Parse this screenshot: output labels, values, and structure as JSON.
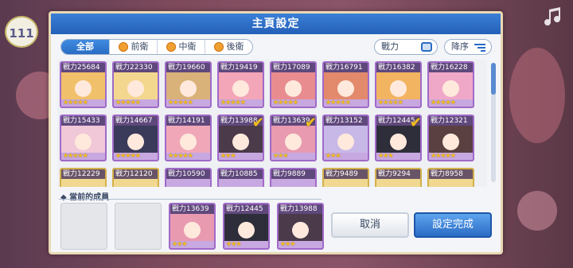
{
  "side": {
    "counter": "111"
  },
  "dialog": {
    "title": "主頁設定",
    "tabs": [
      {
        "label": "全部",
        "active": true,
        "icon": ""
      },
      {
        "label": "前衛",
        "active": false,
        "icon": "vanguard-icon"
      },
      {
        "label": "中衛",
        "active": false,
        "icon": "midguard-icon"
      },
      {
        "label": "後衛",
        "active": false,
        "icon": "rearguard-icon"
      }
    ],
    "sort": {
      "power_label": "戰力",
      "order_label": "降序"
    },
    "cards": [
      {
        "power": "戰力25684",
        "stars": "★★★★★",
        "border": "purple",
        "selected": false,
        "hue": "#f1c06a"
      },
      {
        "power": "戰力22330",
        "stars": "★★★★★",
        "border": "purple",
        "selected": false,
        "hue": "#f4d78e"
      },
      {
        "power": "戰力19660",
        "stars": "★★★★★",
        "border": "purple",
        "selected": false,
        "hue": "#d9b27a"
      },
      {
        "power": "戰力19419",
        "stars": "★★★★★",
        "border": "purple",
        "selected": false,
        "hue": "#f3a6b8"
      },
      {
        "power": "戰力17089",
        "stars": "★★★★★",
        "border": "purple",
        "selected": false,
        "hue": "#e88c90"
      },
      {
        "power": "戰力16791",
        "stars": "★★★★★",
        "border": "purple",
        "selected": false,
        "hue": "#e38a6c"
      },
      {
        "power": "戰力16382",
        "stars": "★★★★★",
        "border": "purple",
        "selected": false,
        "hue": "#f2b460"
      },
      {
        "power": "戰力16228",
        "stars": "★★★★★",
        "border": "purple",
        "selected": false,
        "hue": "#f0a8c8"
      },
      {
        "power": "戰力15433",
        "stars": "★★★★★",
        "border": "purple",
        "selected": false,
        "hue": "#f0c8d8"
      },
      {
        "power": "戰力14667",
        "stars": "★★★★★",
        "border": "purple",
        "selected": false,
        "hue": "#3a3a5a"
      },
      {
        "power": "戰力14191",
        "stars": "★★★★★",
        "border": "purple",
        "selected": false,
        "hue": "#f0a8b8"
      },
      {
        "power": "戰力13988",
        "stars": "★★★",
        "border": "purple",
        "selected": true,
        "hue": "#4a3a4a"
      },
      {
        "power": "戰力13639",
        "stars": "★★★",
        "border": "purple",
        "selected": true,
        "hue": "#e89ab0"
      },
      {
        "power": "戰力13152",
        "stars": "★★★",
        "border": "purple",
        "selected": false,
        "hue": "#c8b8e8"
      },
      {
        "power": "戰力12445",
        "stars": "★★★",
        "border": "purple",
        "selected": true,
        "hue": "#2e2e3a"
      },
      {
        "power": "戰力12321",
        "stars": "★★★★★",
        "border": "purple",
        "selected": false,
        "hue": "#5a4040"
      },
      {
        "power": "戰力12229",
        "stars": "",
        "border": "gold",
        "selected": false,
        "hue": "#f0d890"
      },
      {
        "power": "戰力12120",
        "stars": "",
        "border": "gold",
        "selected": false,
        "hue": "#f0d890"
      },
      {
        "power": "戰力10590",
        "stars": "",
        "border": "purple",
        "selected": false,
        "hue": "#c8a8e0"
      },
      {
        "power": "戰力10885",
        "stars": "",
        "border": "purple",
        "selected": false,
        "hue": "#c8a8e0"
      },
      {
        "power": "戰力9889",
        "stars": "",
        "border": "purple",
        "selected": false,
        "hue": "#c8a8e0"
      },
      {
        "power": "戰力9489",
        "stars": "",
        "border": "gold",
        "selected": false,
        "hue": "#f0d890"
      },
      {
        "power": "戰力9294",
        "stars": "",
        "border": "gold",
        "selected": false,
        "hue": "#f0d890"
      },
      {
        "power": "戰力8958",
        "stars": "",
        "border": "gold",
        "selected": false,
        "hue": "#f0d890"
      }
    ],
    "members_label": "當前的成員",
    "members": [
      {
        "power": "戰力13639",
        "stars": "★★★",
        "hue": "#e89ab0"
      },
      {
        "power": "戰力12445",
        "stars": "★★★",
        "hue": "#2e2e3a"
      },
      {
        "power": "戰力13988",
        "stars": "★★★",
        "hue": "#4a3a4a"
      }
    ],
    "cancel_label": "取消",
    "confirm_label": "設定完成"
  }
}
